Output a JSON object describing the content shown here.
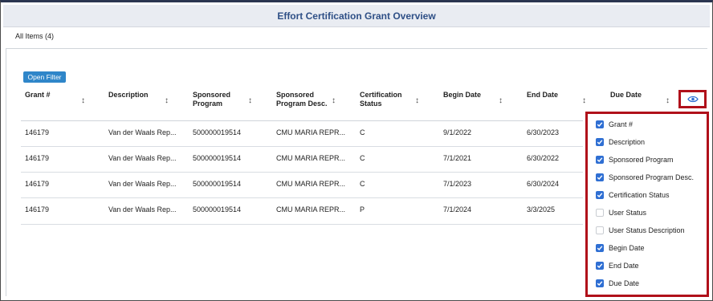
{
  "title": "Effort Certification Grant Overview",
  "list_view": "All Items (4)",
  "open_filter_label": "Open Filter",
  "columns": [
    {
      "l1": "Grant #",
      "l2": ""
    },
    {
      "l1": "Description",
      "l2": ""
    },
    {
      "l1": "Sponsored",
      "l2": "Program"
    },
    {
      "l1": "Sponsored",
      "l2": "Program Desc."
    },
    {
      "l1": "Certification",
      "l2": "Status"
    },
    {
      "l1": "Begin Date",
      "l2": ""
    },
    {
      "l1": "End Date",
      "l2": ""
    },
    {
      "l1": "Due Date",
      "l2": ""
    }
  ],
  "sort_icon": "↕",
  "rows": [
    [
      "146179",
      "Van der Waals Rep...",
      "500000019514",
      "CMU MARIA REPR...",
      "C",
      "9/1/2022",
      "6/30/2023"
    ],
    [
      "146179",
      "Van der Waals Rep...",
      "500000019514",
      "CMU MARIA REPR...",
      "C",
      "7/1/2021",
      "6/30/2022"
    ],
    [
      "146179",
      "Van der Waals Rep...",
      "500000019514",
      "CMU MARIA REPR...",
      "C",
      "7/1/2023",
      "6/30/2024"
    ],
    [
      "146179",
      "Van der Waals Rep...",
      "500000019514",
      "CMU MARIA REPR...",
      "P",
      "7/1/2024",
      "3/3/2025"
    ]
  ],
  "column_options": [
    {
      "label": "Grant #",
      "checked": true
    },
    {
      "label": "Description",
      "checked": true
    },
    {
      "label": "Sponsored Program",
      "checked": true
    },
    {
      "label": "Sponsored Program Desc.",
      "checked": true
    },
    {
      "label": "Certification Status",
      "checked": true
    },
    {
      "label": "User Status",
      "checked": false
    },
    {
      "label": "User Status Description",
      "checked": false
    },
    {
      "label": "Begin Date",
      "checked": true
    },
    {
      "label": "End Date",
      "checked": true
    },
    {
      "label": "Due Date",
      "checked": true
    }
  ],
  "colors": {
    "accent": "#2f6fd3",
    "highlight": "#b0101a",
    "title": "#2e4f86",
    "button": "#2f86c9"
  }
}
